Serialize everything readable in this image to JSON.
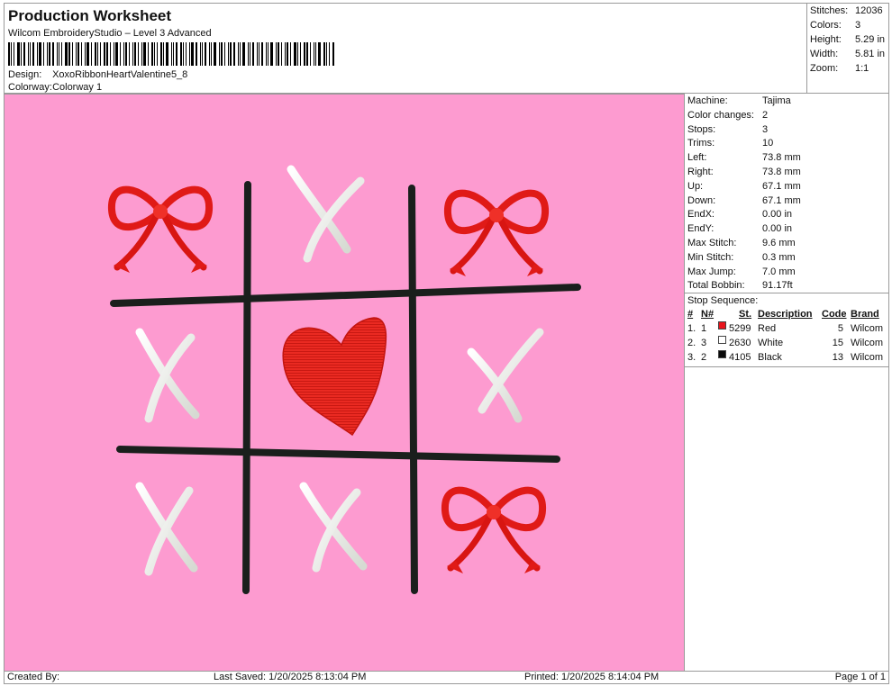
{
  "header": {
    "title": "Production Worksheet",
    "subtitle": "Wilcom EmbroideryStudio – Level 3 Advanced",
    "design_label": "Design:",
    "design_value": "XoxoRibbonHeartValentine5_8",
    "colorway_label": "Colorway:",
    "colorway_value": "Colorway 1"
  },
  "summary": {
    "stitches_label": "Stitches:",
    "stitches": "12036",
    "colors_label": "Colors:",
    "colors": "3",
    "height_label": "Height:",
    "height": "5.29 in",
    "width_label": "Width:",
    "width": "5.81 in",
    "zoom_label": "Zoom:",
    "zoom": "1:1"
  },
  "stats": [
    {
      "label": "Machine:",
      "value": "Tajima"
    },
    {
      "label": "Color changes:",
      "value": "2"
    },
    {
      "label": "Stops:",
      "value": "3"
    },
    {
      "label": "Trims:",
      "value": "10"
    },
    {
      "label": "Left:",
      "value": "73.8 mm"
    },
    {
      "label": "Right:",
      "value": "73.8 mm"
    },
    {
      "label": "Up:",
      "value": "67.1 mm"
    },
    {
      "label": "Down:",
      "value": "67.1 mm"
    },
    {
      "label": "EndX:",
      "value": "0.00 in"
    },
    {
      "label": "EndY:",
      "value": "0.00 in"
    },
    {
      "label": "Max Stitch:",
      "value": "9.6 mm"
    },
    {
      "label": "Min Stitch:",
      "value": "0.3 mm"
    },
    {
      "label": "Max Jump:",
      "value": "7.0 mm"
    },
    {
      "label": "Total Bobbin:",
      "value": "91.17ft"
    }
  ],
  "stop_sequence": {
    "title": "Stop Sequence:",
    "headers": {
      "num": "#",
      "needle": "N#",
      "st": "St.",
      "description": "Description",
      "code": "Code",
      "brand": "Brand"
    },
    "rows": [
      {
        "num": "1.",
        "needle": "1",
        "color": "#e8141c",
        "st": "5299",
        "description": "Red",
        "code": "5",
        "brand": "Wilcom"
      },
      {
        "num": "2.",
        "needle": "3",
        "color": "#ffffff",
        "st": "2630",
        "description": "White",
        "code": "15",
        "brand": "Wilcom"
      },
      {
        "num": "3.",
        "needle": "2",
        "color": "#0a0a0a",
        "st": "4105",
        "description": "Black",
        "code": "13",
        "brand": "Wilcom"
      }
    ]
  },
  "design": {
    "background": "#fd9bd0",
    "thread_colors": {
      "red": "#e8141c",
      "white": "#f4f4f0",
      "black": "#1a1f1c"
    },
    "grid_cells": [
      "bow",
      "x",
      "bow",
      "x",
      "heart",
      "x",
      "x",
      "x",
      "bow"
    ]
  },
  "footer": {
    "created_by": "Created By:",
    "last_saved": "Last Saved: 1/20/2025 8:13:04 PM",
    "printed": "Printed: 1/20/2025 8:14:04 PM",
    "page": "Page 1 of 1"
  }
}
